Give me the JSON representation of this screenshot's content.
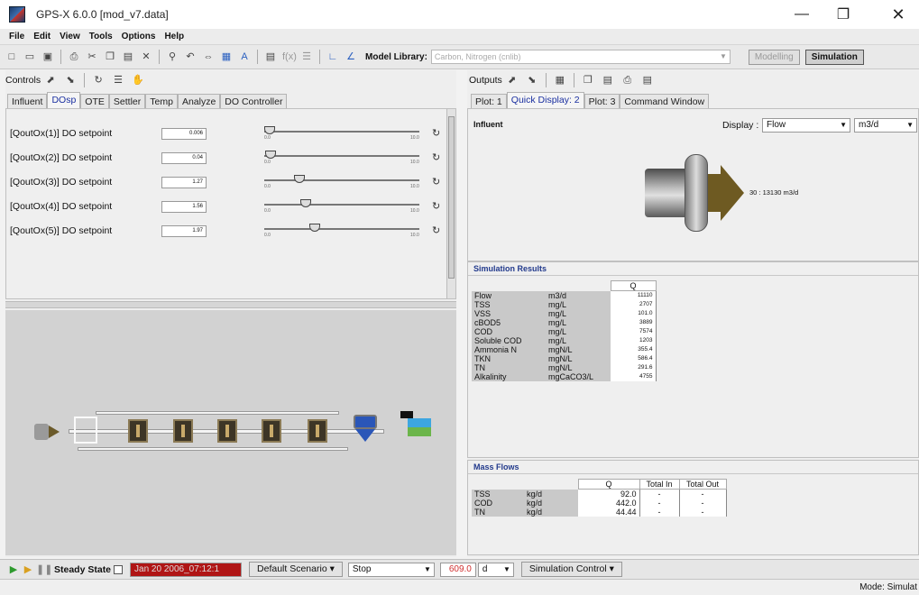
{
  "window": {
    "title": "GPS-X 6.0.0 [mod_v7.data]"
  },
  "menu": [
    "File",
    "Edit",
    "View",
    "Tools",
    "Options",
    "Help"
  ],
  "toolbar": {
    "library_label": "Model Library:",
    "library_value": "Carbon, Nitrogen (cnlib)",
    "modelling_label": "Modelling",
    "simulation_label": "Simulation"
  },
  "controls": {
    "title": "Controls",
    "tabs": [
      "Influent",
      "DOsp",
      "OTE",
      "Settler",
      "Temp",
      "Analyze",
      "DO Controller"
    ],
    "active_tab": 1,
    "rows": [
      {
        "label": "[QoutOx(1)] DO setpoint",
        "value": "0.006",
        "min": "0.0",
        "max": "10.0",
        "level": 0.0006
      },
      {
        "label": "[QoutOx(2)] DO setpoint",
        "value": "0.04",
        "min": "0.0",
        "max": "10.0",
        "level": 0.004
      },
      {
        "label": "[QoutOx(3)] DO setpoint",
        "value": "1.27",
        "min": "0.0",
        "max": "10.0",
        "level": 0.127
      },
      {
        "label": "[QoutOx(4)] DO setpoint",
        "value": "1.56",
        "min": "0.0",
        "max": "10.0",
        "level": 0.156
      },
      {
        "label": "[QoutOx(5)] DO setpoint",
        "value": "1.97",
        "min": "0.0",
        "max": "10.0",
        "level": 0.197
      }
    ]
  },
  "outputs": {
    "title": "Outputs",
    "tabs": [
      "Plot: 1",
      "Quick Display: 2",
      "Plot: 3",
      "Command Window"
    ],
    "active_tab": 1,
    "influent_label": "Influent",
    "display_label": "Display :",
    "display_value": "Flow",
    "unit_value": "m3/d",
    "flow_annotation": "30 : 13130 m3/d"
  },
  "simulation_results": {
    "title": "Simulation Results",
    "column": "Q",
    "rows": [
      {
        "name": "Flow",
        "unit": "m3/d",
        "value": "11110"
      },
      {
        "name": "TSS",
        "unit": "mg/L",
        "value": "2707"
      },
      {
        "name": "VSS",
        "unit": "mg/L",
        "value": "101.0"
      },
      {
        "name": "cBOD5",
        "unit": "mg/L",
        "value": "3889"
      },
      {
        "name": "COD",
        "unit": "mg/L",
        "value": "7574"
      },
      {
        "name": "Soluble COD",
        "unit": "mg/L",
        "value": "1203"
      },
      {
        "name": "Ammonia N",
        "unit": "mgN/L",
        "value": "355.4"
      },
      {
        "name": "TKN",
        "unit": "mgN/L",
        "value": "586.4"
      },
      {
        "name": "TN",
        "unit": "mgN/L",
        "value": "291.6"
      },
      {
        "name": "Alkalinity",
        "unit": "mgCaCO3/L",
        "value": "4755"
      }
    ]
  },
  "mass_flows": {
    "title": "Mass Flows",
    "columns": [
      "Q",
      "Total In",
      "Total Out"
    ],
    "rows": [
      {
        "name": "TSS",
        "unit": "kg/d",
        "q": "92.0",
        "total_in": "-",
        "total_out": "-"
      },
      {
        "name": "COD",
        "unit": "kg/d",
        "q": "442.0",
        "total_in": "-",
        "total_out": "-"
      },
      {
        "name": "TN",
        "unit": "kg/d",
        "q": "44.44",
        "total_in": "-",
        "total_out": "-"
      }
    ]
  },
  "footer": {
    "steady_state_label": "Steady State",
    "date_value": "Jan 20 2006_07:12:1",
    "scenario_label": "Default Scenario",
    "stop_value": "Stop",
    "time_value": "609.0",
    "time_unit": "d",
    "sim_control_label": "Simulation Control"
  },
  "status": {
    "mode": "Mode: Simulat"
  }
}
